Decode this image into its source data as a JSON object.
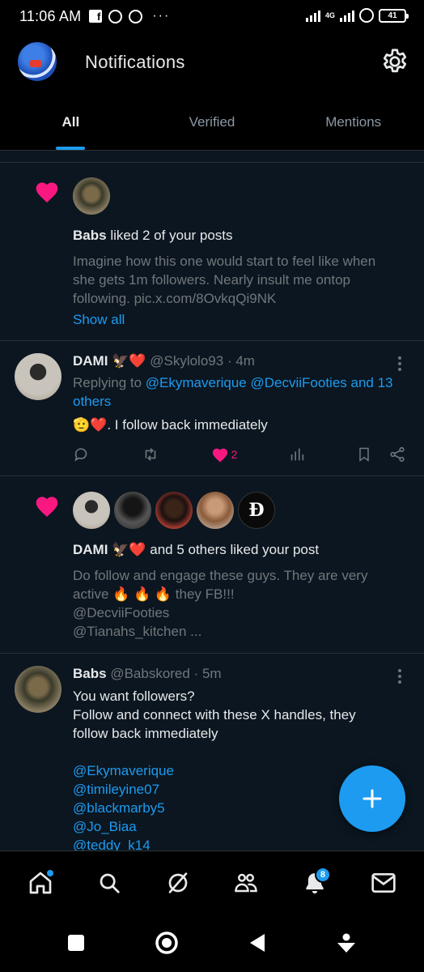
{
  "status": {
    "time": "11:06 AM",
    "network": "4G",
    "battery": "41"
  },
  "header": {
    "title": "Notifications"
  },
  "tabs": [
    {
      "label": "All"
    },
    {
      "label": "Verified"
    },
    {
      "label": "Mentions"
    }
  ],
  "notifications": {
    "like1": {
      "actor": "Babs",
      "action": "liked 2 of your posts",
      "preview": [
        "Imagine how this one would start to feel like when",
        "she gets 1m followers. Nearly insult me ontop",
        "following. pic.x.com/8OvkqQi9NK"
      ],
      "show_all": "Show all"
    },
    "reply": {
      "name": "DAMI 🦅❤️",
      "handle": "@Skylolo93",
      "time": "· 4m",
      "replying_prefix": "Replying to",
      "replying_users": "@Ekymaverique @DecviiFooties and 13",
      "replying_others": "others",
      "text": "🫡❤️. I follow back immediately",
      "like_count": "2"
    },
    "like2": {
      "actor": "DAMI 🦅❤️",
      "action": "and 5 others liked your post",
      "preview": [
        "Do follow and engage these guys.  They are very",
        "active 🔥 🔥 🔥 they FB!!!",
        "@DecviiFooties",
        "@Tianahs_kitchen ..."
      ],
      "logo_letter": "Ð"
    },
    "post": {
      "name": "Babs",
      "handle": "@Babskored",
      "time": "· 5m",
      "lines": [
        "You want followers?",
        "Follow and connect with these X handles, they",
        "follow back immediately"
      ],
      "mentions": [
        "@Ekymaverique",
        "@timileyine07",
        "@blackmarby5",
        "@Jo_Biaa",
        "@teddy_k14"
      ]
    }
  },
  "bottom_nav": {
    "notifications_badge": "8"
  },
  "colors": {
    "accent": "#1d9bf0",
    "like": "#f91880",
    "feed_bg": "#0b1620"
  }
}
